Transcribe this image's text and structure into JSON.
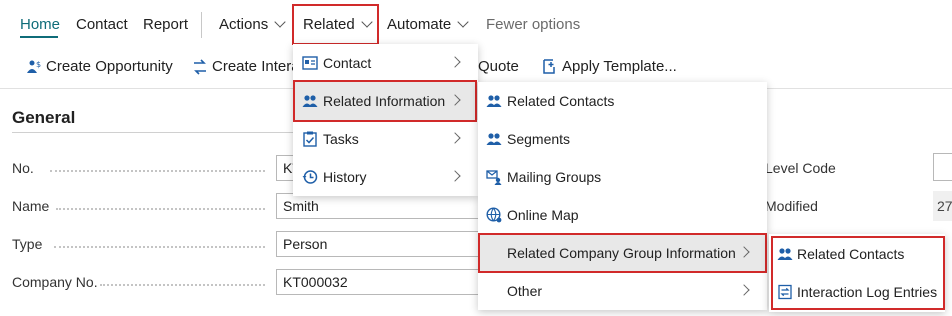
{
  "topbar": {
    "tabs": {
      "home": "Home",
      "contact": "Contact",
      "report": "Report",
      "actions": "Actions",
      "related": "Related",
      "automate": "Automate",
      "fewer": "Fewer options"
    }
  },
  "actionbar": {
    "create_opportunity": "Create Opportunity",
    "create_interaction": "Create Intera",
    "quote": "Quote",
    "apply_template": "Apply Template..."
  },
  "general": {
    "title": "General",
    "fields": [
      {
        "label": "No.",
        "value": "KT"
      },
      {
        "label": "Name",
        "value": "Smith"
      },
      {
        "label": "Type",
        "value": "Person"
      },
      {
        "label": "Company No.",
        "value": "KT000032"
      }
    ],
    "right_labels": {
      "level_code": "Level Code",
      "modified": "Modified",
      "modified_value": "27"
    }
  },
  "related_menu": {
    "items": [
      "Contact",
      "Related Information",
      "Tasks",
      "History"
    ]
  },
  "related_info_menu": {
    "items": [
      "Related Contacts",
      "Segments",
      "Mailing Groups",
      "Online Map",
      "Related Company Group Information",
      "Other"
    ]
  },
  "company_group_menu": {
    "items": [
      "Related Contacts",
      "Interaction Log Entries"
    ]
  },
  "colors": {
    "accent": "#0f6c79",
    "highlight_border": "#d12a2a",
    "icon_blue": "#1f5fa8"
  }
}
